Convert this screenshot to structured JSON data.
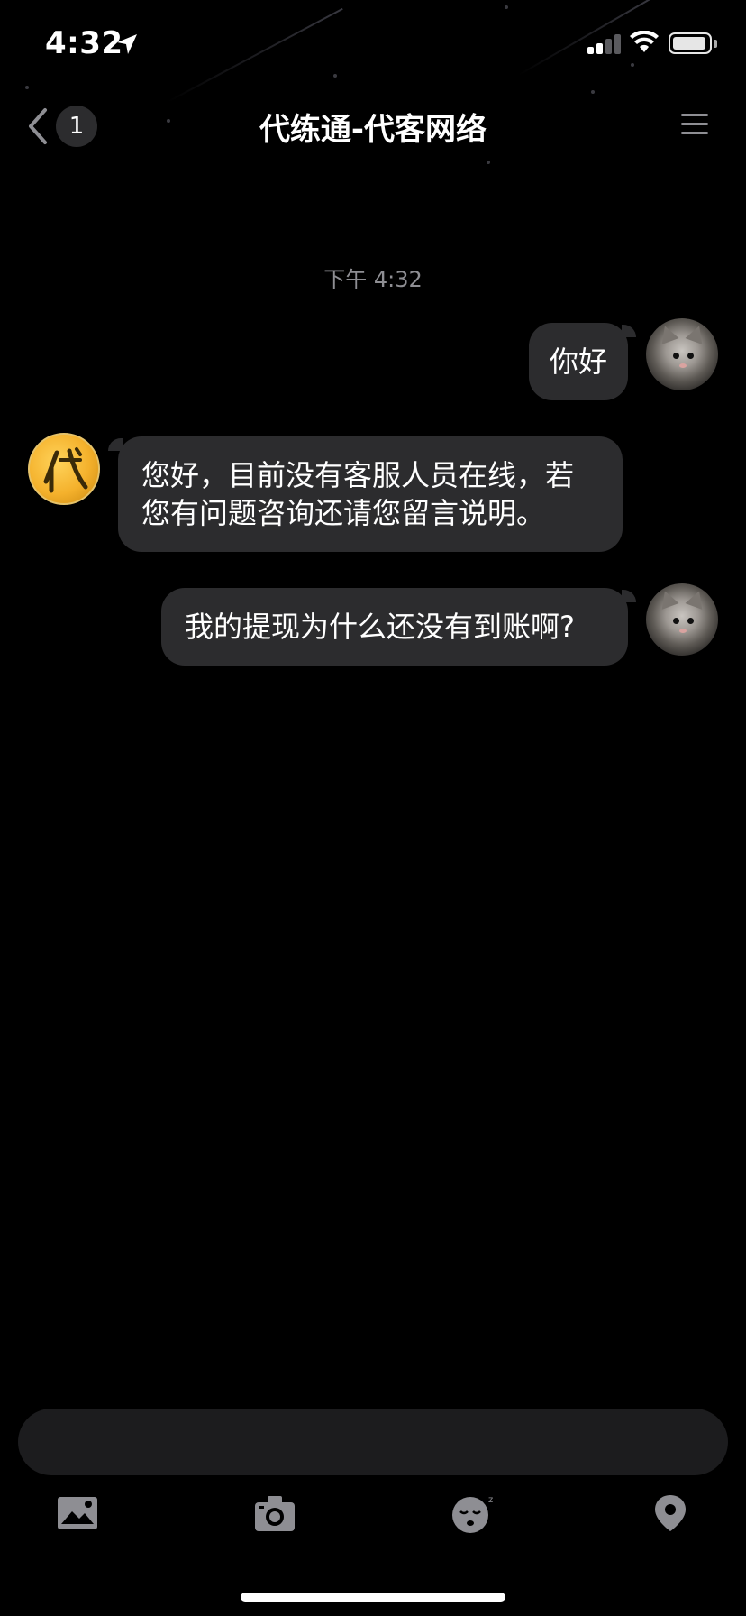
{
  "status_bar": {
    "time": "4:32"
  },
  "nav": {
    "unread_count": "1",
    "title": "代练通-代客网络"
  },
  "chat": {
    "timestamp": "下午 4:32",
    "messages": [
      {
        "from": "me",
        "text": "你好"
      },
      {
        "from": "service",
        "line1": "您好，目前没有客服人员在线，若",
        "line2": "您有问题咨询还请您留言说明。"
      },
      {
        "from": "me",
        "text": "我的提现为什么还没有到账啊?"
      }
    ]
  },
  "composer": {
    "value": "",
    "placeholder": ""
  },
  "toolbar": {
    "icons": [
      "image-icon",
      "camera-icon",
      "emoji-icon",
      "location-icon"
    ]
  },
  "colors": {
    "background": "#000000",
    "bubble": "#2c2c2e",
    "input": "#1c1c1e",
    "icon_gray": "#8e8e93"
  }
}
